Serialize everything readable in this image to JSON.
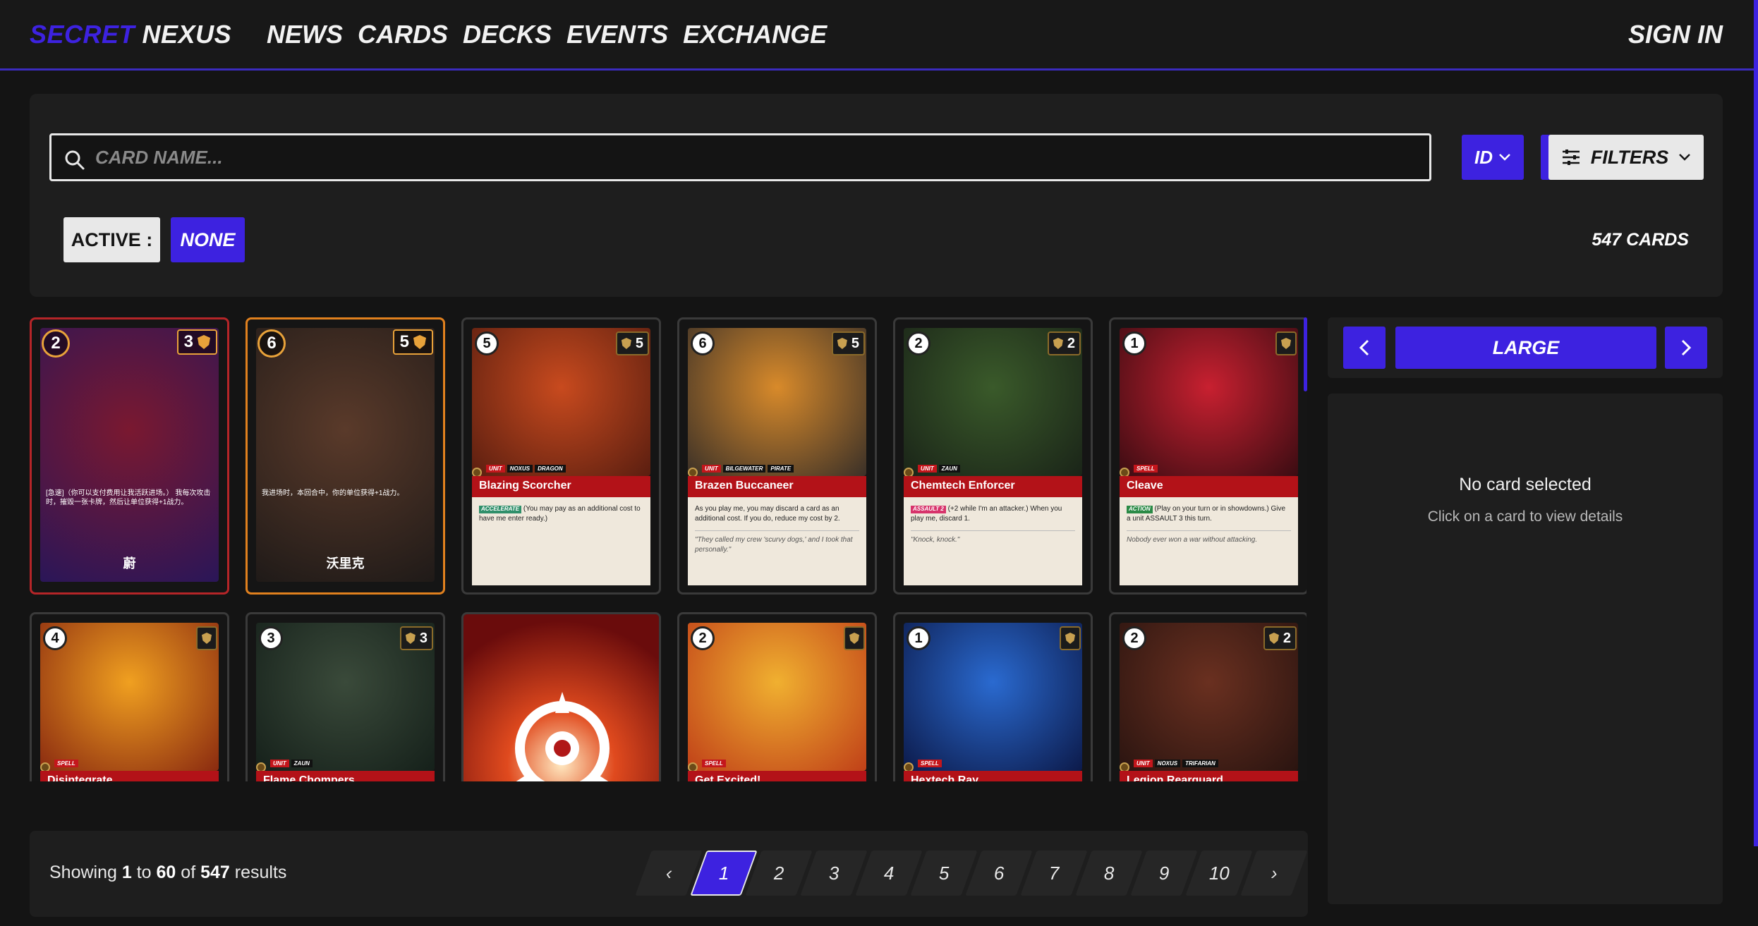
{
  "nav": {
    "logo_part1": "SECRET",
    "logo_part2": "NEXUS",
    "links": [
      "NEWS",
      "CARDS",
      "DECKS",
      "EVENTS",
      "EXCHANGE"
    ],
    "signin": "SIGN IN"
  },
  "search": {
    "placeholder": "CARD NAME...",
    "sort_field": "ID",
    "filters_label": "FILTERS",
    "active_label": "ACTIVE :",
    "active_value": "NONE",
    "count": "547 CARDS"
  },
  "cards": [
    {
      "style": "cn",
      "cost": "2",
      "might": "3",
      "name": "蔚",
      "text": "[急速]（你可以支付费用让我活跃进场。）\n我每次攻击时，摧毁一张卡牌，然后让单位获得+1战力。",
      "art_from": "#7a1830",
      "art_to": "#2a1658",
      "border": "#b52528"
    },
    {
      "style": "cn",
      "cost": "6",
      "might": "5",
      "name": "沃里克",
      "text": "我进场时，本回合中，你的单位获得+1战力。",
      "art_from": "#5a3a2a",
      "art_to": "#1f1a18",
      "border": "#e0801e"
    },
    {
      "style": "en",
      "cost": "5",
      "might": "5",
      "tags": [
        "UNIT",
        "NOXUS",
        "DRAGON"
      ],
      "name": "Blazing Scorcher",
      "keyword": "ACCELERATE",
      "kw_class": "",
      "text": "(You may pay as an additional cost to have me enter ready.)",
      "flavor": "",
      "art_from": "#c84a1e",
      "art_to": "#5a1e10"
    },
    {
      "style": "en",
      "cost": "6",
      "might": "5",
      "tags": [
        "UNIT",
        "BILGEWATER",
        "PIRATE"
      ],
      "name": "Brazen Buccaneer",
      "keyword": "",
      "kw_class": "",
      "text": "As you play me, you may discard a card as an additional cost. If you do, reduce my cost by 2.",
      "flavor": "\"They called my crew 'scurvy dogs,' and I took that personally.\"",
      "art_from": "#d88a2a",
      "art_to": "#3a3028"
    },
    {
      "style": "en",
      "cost": "2",
      "might": "2",
      "tags": [
        "UNIT",
        "ZAUN"
      ],
      "name": "Chemtech Enforcer",
      "keyword": "ASSAULT 2",
      "kw_class": "pink",
      "text": "(+2 while I'm an attacker.) When you play me, discard 1.",
      "flavor": "\"Knock, knock.\"",
      "art_from": "#3a5a2a",
      "art_to": "#1a2418"
    },
    {
      "style": "en",
      "cost": "1",
      "might": "",
      "tags": [
        "SPELL"
      ],
      "name": "Cleave",
      "keyword": "ACTION",
      "kw_class": "green",
      "text": "(Play on your turn or in showdowns.) Give a unit ASSAULT 3 this turn.",
      "flavor": "Nobody ever won a war without attacking.",
      "art_from": "#c82030",
      "art_to": "#3a0c12"
    },
    {
      "style": "en",
      "cost": "4",
      "might": "",
      "tags": [
        "SPELL"
      ],
      "name": "Disintegrate",
      "keyword": "",
      "kw_class": "",
      "text": "",
      "flavor": "",
      "art_from": "#f0a020",
      "art_to": "#8a2a10"
    },
    {
      "style": "en",
      "cost": "3",
      "might": "3",
      "tags": [
        "UNIT",
        "ZAUN"
      ],
      "name": "Flame Chompers",
      "keyword": "",
      "kw_class": "",
      "text": "",
      "flavor": "",
      "art_from": "#3a4a3a",
      "art_to": "#15201a"
    },
    {
      "style": "back",
      "cost": "",
      "might": "",
      "tags": [],
      "name": "",
      "keyword": "",
      "kw_class": "",
      "text": "",
      "flavor": "",
      "art_from": "#e04a1e",
      "art_to": "#6a0c0c"
    },
    {
      "style": "en",
      "cost": "2",
      "might": "",
      "tags": [
        "SPELL"
      ],
      "name": "Get Excited!",
      "keyword": "",
      "kw_class": "",
      "text": "",
      "flavor": "",
      "art_from": "#f0b030",
      "art_to": "#c04018"
    },
    {
      "style": "en",
      "cost": "1",
      "might": "",
      "tags": [
        "SPELL"
      ],
      "name": "Hextech Ray",
      "keyword": "",
      "kw_class": "",
      "text": "",
      "flavor": "",
      "art_from": "#2a6ad0",
      "art_to": "#0c1a4a"
    },
    {
      "style": "en",
      "cost": "2",
      "might": "2",
      "tags": [
        "UNIT",
        "NOXUS",
        "TRIFARIAN"
      ],
      "name": "Legion Rearguard",
      "keyword": "",
      "kw_class": "",
      "text": "",
      "flavor": "",
      "art_from": "#6a3020",
      "art_to": "#2a1410"
    }
  ],
  "pagination": {
    "showing": "Showing",
    "from": "1",
    "to_word": "to",
    "to": "60",
    "of_word": "of",
    "total": "547",
    "results": "results",
    "prev": "‹",
    "next": "›",
    "pages": [
      "1",
      "2",
      "3",
      "4",
      "5",
      "6",
      "7",
      "8",
      "9",
      "10"
    ],
    "current": "1"
  },
  "detail": {
    "size_label": "LARGE",
    "title": "No card selected",
    "subtitle": "Click on a card to view details"
  }
}
